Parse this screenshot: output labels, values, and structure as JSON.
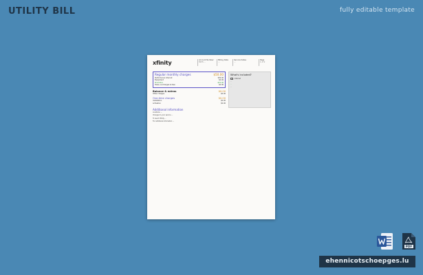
{
  "page": {
    "title": "UTILITY BILL",
    "subtitle": "fully editable template",
    "site_label": "ehennicotschoepges.lu"
  },
  "document": {
    "logo": "xfinity",
    "header": [
      {
        "label": "Account Number",
        "value": "8155 ..."
      },
      {
        "label": "Billing Date",
        "value": "..."
      },
      {
        "label": "Service Dates",
        "value": "..."
      },
      {
        "label": "Page",
        "value": "1 of 2"
      }
    ],
    "charges": {
      "title": "Regular monthly charges",
      "amount": "$50.00",
      "rows": [
        {
          "label": "Performance Internet",
          "value": "$50.00",
          "green": false
        },
        {
          "label": "Equipment",
          "value": "$0.00",
          "green": false
        },
        {
          "label": "Promotion",
          "value": "-$10.00",
          "green": true
        },
        {
          "label": "Taxes, surcharges & fees",
          "value": "$0.00",
          "green": false
        }
      ]
    },
    "balance": {
      "title": "Balance & extras",
      "amount": "$0.00",
      "row_label": "Other charges",
      "row_value": "$0.00"
    },
    "onetime": {
      "title": "One-time charges",
      "amount": "$0.00",
      "row_label": "Installation",
      "row_value": "$0.00",
      "row_label2": "Activation",
      "row_value2": "$0.00"
    },
    "additional": {
      "title": "Additional information",
      "paragraphs": [
        "Locations: ...",
        "Changes to your service ...",
        "To reach Xfinity ...",
        "For additional information ..."
      ]
    },
    "included": {
      "title": "What's included?",
      "items": [
        "Internet"
      ],
      "note1": "...",
      "note_green": "...",
      "note2": "..."
    }
  },
  "colors": {
    "background": "#4a88b4",
    "label_bg": "#1f3447",
    "accent_purple": "#4f49c0",
    "accent_orange": "#d08a1f",
    "accent_green": "#3aa24a",
    "word_blue": "#2b579a",
    "pdf_dark": "#1f3447"
  }
}
